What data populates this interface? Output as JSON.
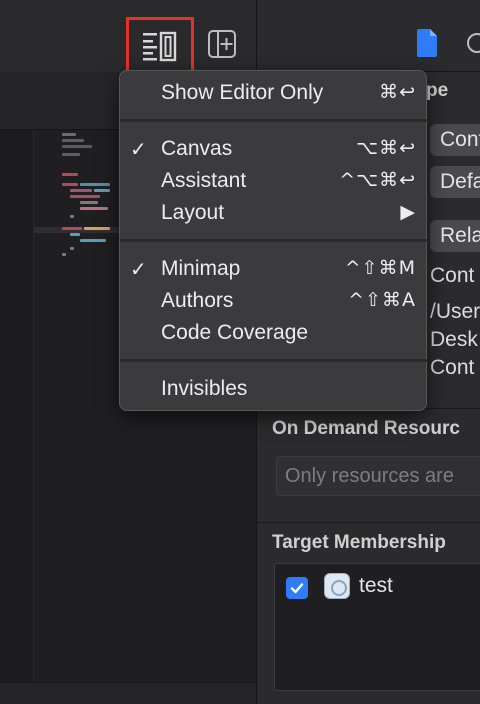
{
  "toolbar": {
    "editor_options_icon": "editor-options-icon",
    "add_editor_icon": "add-editor-right-icon",
    "file_inspector_icon": "file-icon",
    "history_inspector_icon": "history-icon"
  },
  "menu": {
    "items": [
      {
        "check": "",
        "label": "Show Editor Only",
        "shortcut": "⌘↩"
      },
      {
        "check": "✓",
        "label": "Canvas",
        "shortcut": "⌥⌘↩"
      },
      {
        "check": "",
        "label": "Assistant",
        "shortcut": "^⌥⌘↩"
      },
      {
        "check": "",
        "label": "Layout",
        "shortcut": "▶"
      },
      {
        "check": "✓",
        "label": "Minimap",
        "shortcut": "^⇧⌘M"
      },
      {
        "check": "",
        "label": "Authors",
        "shortcut": "^⇧⌘A"
      },
      {
        "check": "",
        "label": "Code Coverage",
        "shortcut": ""
      },
      {
        "check": "",
        "label": "Invisibles",
        "shortcut": ""
      }
    ]
  },
  "inspector": {
    "type_fragment": "pe",
    "popup1": "Cont",
    "popup2": "Defa",
    "popup3": "Rela",
    "location_fragment": "Cont",
    "path_line1": "/User",
    "path_line2": "Desk",
    "path_line3": "Cont",
    "on_demand_heading": "On Demand Resourc",
    "on_demand_info": "Only resources are",
    "target_membership_heading": "Target Membership",
    "target_name": "test",
    "target_checked": true
  },
  "colors": {
    "highlight_box": "#e8302a",
    "accent_blue": "#2f7cf6",
    "menu_bg": "#3b3b3d"
  }
}
